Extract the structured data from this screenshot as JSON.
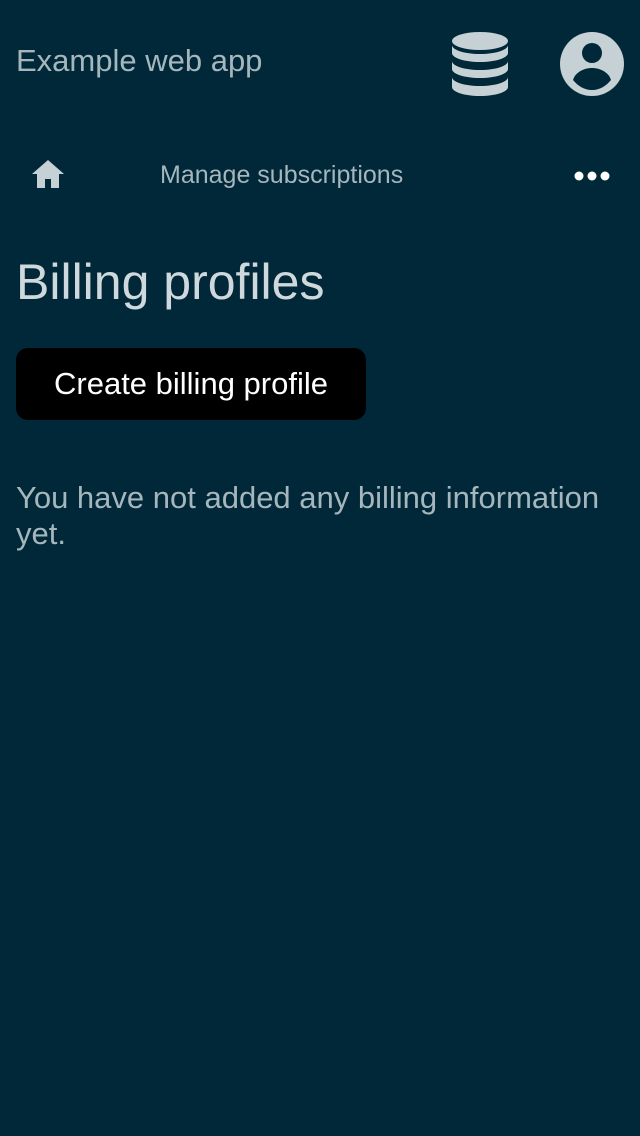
{
  "header": {
    "app_title": "Example web app",
    "database_icon": "database-icon",
    "account_icon": "account-circle-icon"
  },
  "nav": {
    "home_icon": "home-icon",
    "manage_subscriptions_label": "Manage subscriptions",
    "more_icon": "more-horizontal-icon"
  },
  "main": {
    "title": "Billing profiles",
    "create_button_label": "Create billing profile",
    "empty_message": "You have not added any billing information yet."
  },
  "colors": {
    "background": "#002838",
    "text_muted": "#a6b6bd",
    "title_text": "#cfd9dd",
    "button_bg": "#000000",
    "button_text": "#ffffff",
    "icon": "#c5d1d5"
  }
}
